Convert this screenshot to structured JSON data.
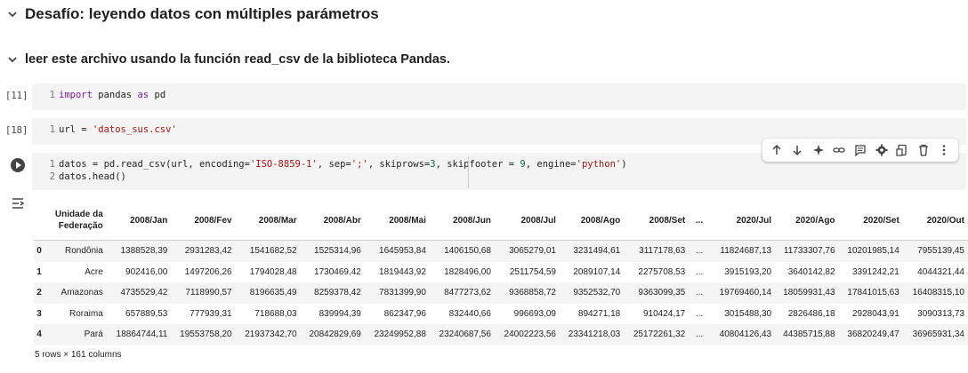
{
  "headings": {
    "h1": "Desafío: leyendo datos con múltiples parámetros",
    "h2": "leer este archivo usando la función read_csv de la biblioteca Pandas."
  },
  "cells": [
    {
      "count": "[11]",
      "lines": [
        {
          "n": "1",
          "code": "import pandas as pd"
        }
      ]
    },
    {
      "count": "[18]",
      "lines": [
        {
          "n": "1",
          "code": "url = 'datos_sus.csv'"
        }
      ]
    },
    {
      "count": "",
      "lines": [
        {
          "n": "1",
          "code": "datos = pd.read_csv(url, encoding='ISO-8859-1', sep=';', skiprows=3, skipfooter = 9, engine='python')"
        },
        {
          "n": "2",
          "code": "datos.head()"
        }
      ]
    }
  ],
  "toolbar_icons": [
    "arrow-up-icon",
    "arrow-down-icon",
    "sparkle-icon",
    "link-icon",
    "comment-icon",
    "gear-icon",
    "mirror-cell-icon",
    "trash-icon",
    "more-vert-icon"
  ],
  "dataframe": {
    "columns": [
      "Unidade da Federação",
      "2008/Jan",
      "2008/Fev",
      "2008/Mar",
      "2008/Abr",
      "2008/Mai",
      "2008/Jun",
      "2008/Jul",
      "2008/Ago",
      "2008/Set",
      "...",
      "2020/Jul",
      "2020/Ago",
      "2020/Set",
      "2020/Out"
    ],
    "rows": [
      {
        "index": "0",
        "values": [
          "Rondônia",
          "1388528,39",
          "2931283,42",
          "1541682,52",
          "1525314,96",
          "1645953,84",
          "1406150,68",
          "3065279,01",
          "3231494,61",
          "3117178,63",
          "...",
          "11824687,13",
          "11733307,76",
          "10201985,14",
          "7955139,45"
        ]
      },
      {
        "index": "1",
        "values": [
          "Acre",
          "902416,00",
          "1497206,26",
          "1794028,48",
          "1730469,42",
          "1819443,92",
          "1828496,00",
          "2511754,59",
          "2089107,14",
          "2275708,53",
          "...",
          "3915193,20",
          "3640142,82",
          "3391242,21",
          "4044321,44"
        ]
      },
      {
        "index": "2",
        "values": [
          "Amazonas",
          "4735529,42",
          "7118990,57",
          "8196635,49",
          "8259378,42",
          "7831399,90",
          "8477273,62",
          "9368858,72",
          "9352532,70",
          "9363099,35",
          "...",
          "19769460,14",
          "18059931,43",
          "17841015,63",
          "16408315,10"
        ]
      },
      {
        "index": "3",
        "values": [
          "Roraima",
          "657889,53",
          "777939,31",
          "718688,03",
          "839994,39",
          "862347,96",
          "832440,66",
          "996693,09",
          "894271,18",
          "910424,17",
          "...",
          "3015488,30",
          "2826486,18",
          "2928043,91",
          "3090313,73"
        ]
      },
      {
        "index": "4",
        "values": [
          "Pará",
          "18864744,11",
          "19553758,20",
          "21937342,70",
          "20842829,69",
          "23249952,88",
          "23240687,56",
          "24002223,56",
          "23341218,03",
          "25172261,32",
          "...",
          "40804126,43",
          "44385715,88",
          "36820249,47",
          "36965931,34"
        ]
      }
    ],
    "dims": "5 rows × 161 columns"
  }
}
